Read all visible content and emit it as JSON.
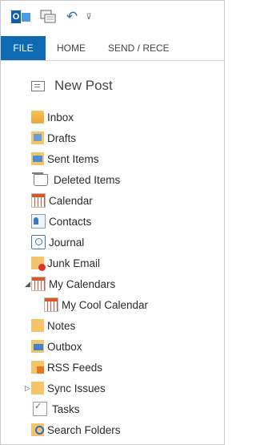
{
  "qat": {
    "icons": [
      "outlook-logo-icon",
      "send-receive-icon",
      "undo-icon",
      "customize-toolbar-icon"
    ],
    "logo_letter": "O",
    "undo_glyph": "↶",
    "customize_glyph": "⊽"
  },
  "tabs": [
    "FILE",
    "HOME",
    "SEND / RECE"
  ],
  "new_post": {
    "label": "New Post"
  },
  "folders": [
    {
      "label": "Inbox",
      "icon": "inbox-icon"
    },
    {
      "label": "Drafts",
      "icon": "drafts-icon"
    },
    {
      "label": "Sent Items",
      "icon": "sent-items-icon"
    },
    {
      "label": "Deleted Items",
      "icon": "deleted-items-icon"
    },
    {
      "label": "Calendar",
      "icon": "calendar-icon"
    },
    {
      "label": "Contacts",
      "icon": "contacts-icon"
    },
    {
      "label": "Journal",
      "icon": "journal-icon"
    },
    {
      "label": "Junk Email",
      "icon": "junk-email-icon"
    },
    {
      "label": "My Calendars",
      "icon": "calendar-group-icon",
      "expand": "◢"
    },
    {
      "label": "My Cool Calendar",
      "icon": "calendar-icon"
    },
    {
      "label": "Notes",
      "icon": "notes-icon"
    },
    {
      "label": "Outbox",
      "icon": "outbox-icon"
    },
    {
      "label": "RSS Feeds",
      "icon": "rss-feeds-icon"
    },
    {
      "label": "Sync Issues",
      "icon": "folder-icon",
      "expand": "▷"
    },
    {
      "label": "Tasks",
      "icon": "tasks-icon"
    },
    {
      "label": "Search Folders",
      "icon": "search-folders-icon"
    }
  ],
  "colors": {
    "file_tab": "#0f6ab4",
    "folder_yellow": "#f4c36a"
  }
}
